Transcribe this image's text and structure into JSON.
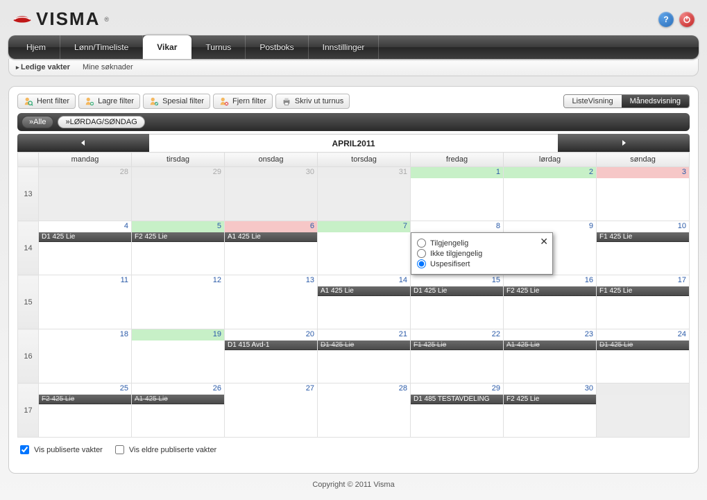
{
  "brand": "VISMA",
  "nav": {
    "tabs": [
      "Hjem",
      "Lønn/Timeliste",
      "Vikar",
      "Turnus",
      "Postboks",
      "Innstillinger"
    ],
    "active": "Vikar",
    "sub": [
      "Ledige vakter",
      "Mine søknader"
    ],
    "sub_active": "Ledige vakter"
  },
  "toolbar": {
    "hent": "Hent filter",
    "lagre": "Lagre filter",
    "spesial": "Spesial filter",
    "fjern": "Fjern filter",
    "skriv": "Skriv ut turnus"
  },
  "view": {
    "list": "ListeVisning",
    "month": "Månedsvisning"
  },
  "filters": {
    "all": "»Alle",
    "weekend": "»LØRDAG/SØNDAG"
  },
  "month_title": "APRIL2011",
  "weekdays": [
    "mandag",
    "tirsdag",
    "onsdag",
    "torsdag",
    "fredag",
    "lørdag",
    "søndag"
  ],
  "weeks": [
    {
      "wk": "13",
      "days": [
        {
          "d": "28",
          "dim": true,
          "hdr": "grey",
          "outside": true
        },
        {
          "d": "29",
          "dim": true,
          "hdr": "grey",
          "outside": true
        },
        {
          "d": "30",
          "dim": true,
          "hdr": "grey",
          "outside": true
        },
        {
          "d": "31",
          "dim": true,
          "hdr": "grey",
          "outside": true
        },
        {
          "d": "1",
          "hdr": "green"
        },
        {
          "d": "2",
          "hdr": "green"
        },
        {
          "d": "3",
          "hdr": "pink"
        }
      ]
    },
    {
      "wk": "14",
      "days": [
        {
          "d": "4",
          "hdr": "white",
          "events": [
            {
              "t": "D1 425 Lie"
            }
          ]
        },
        {
          "d": "5",
          "hdr": "green",
          "events": [
            {
              "t": "F2 425 Lie"
            }
          ]
        },
        {
          "d": "6",
          "hdr": "pink",
          "events": [
            {
              "t": "A1 425 Lie"
            }
          ]
        },
        {
          "d": "7",
          "hdr": "green"
        },
        {
          "d": "8",
          "hdr": "white"
        },
        {
          "d": "9",
          "hdr": "white"
        },
        {
          "d": "10",
          "hdr": "white",
          "events": [
            {
              "t": "F1 425 Lie"
            }
          ]
        }
      ]
    },
    {
      "wk": "15",
      "days": [
        {
          "d": "11",
          "hdr": "white"
        },
        {
          "d": "12",
          "hdr": "white"
        },
        {
          "d": "13",
          "hdr": "white"
        },
        {
          "d": "14",
          "hdr": "white",
          "events": [
            {
              "t": "A1 425 Lie"
            }
          ]
        },
        {
          "d": "15",
          "hdr": "white",
          "events": [
            {
              "t": "D1 425 Lie"
            }
          ]
        },
        {
          "d": "16",
          "hdr": "white",
          "events": [
            {
              "t": "F2 425 Lie"
            }
          ]
        },
        {
          "d": "17",
          "hdr": "white",
          "events": [
            {
              "t": "F1 425 Lie"
            }
          ]
        }
      ]
    },
    {
      "wk": "16",
      "days": [
        {
          "d": "18",
          "hdr": "white"
        },
        {
          "d": "19",
          "hdr": "green"
        },
        {
          "d": "20",
          "hdr": "white",
          "events": [
            {
              "t": "D1 415 Avd-1"
            }
          ]
        },
        {
          "d": "21",
          "hdr": "white",
          "events": [
            {
              "t": "D1 425 Lie",
              "strike": true
            }
          ]
        },
        {
          "d": "22",
          "hdr": "white",
          "events": [
            {
              "t": "F1 425 Lie",
              "strike": true
            }
          ]
        },
        {
          "d": "23",
          "hdr": "white",
          "events": [
            {
              "t": "A1 425 Lie",
              "strike": true
            }
          ]
        },
        {
          "d": "24",
          "hdr": "white",
          "events": [
            {
              "t": "D1 425 Lie",
              "strike": true
            }
          ]
        }
      ]
    },
    {
      "wk": "17",
      "days": [
        {
          "d": "25",
          "hdr": "white",
          "events": [
            {
              "t": "F2 425 Lie",
              "strike": true
            }
          ]
        },
        {
          "d": "26",
          "hdr": "white",
          "events": [
            {
              "t": "A1 425 Lie",
              "strike": true
            }
          ]
        },
        {
          "d": "27",
          "hdr": "white"
        },
        {
          "d": "28",
          "hdr": "white"
        },
        {
          "d": "29",
          "hdr": "white",
          "events": [
            {
              "t": "D1 485 TESTAVDELING"
            }
          ]
        },
        {
          "d": "30",
          "hdr": "white",
          "events": [
            {
              "t": "F2 425 Lie"
            }
          ]
        },
        {
          "d": "",
          "hdr": "grey",
          "outside": true
        }
      ]
    }
  ],
  "popover": {
    "opt1": "Tilgjengelig",
    "opt2": "Ikke tilgjengelig",
    "opt3": "Uspesifisert",
    "selected": "Uspesifisert"
  },
  "checks": {
    "publiserte": "Vis publiserte vakter",
    "eldre": "Vis eldre publiserte vakter"
  },
  "footer": "Copyright © 2011 Visma"
}
